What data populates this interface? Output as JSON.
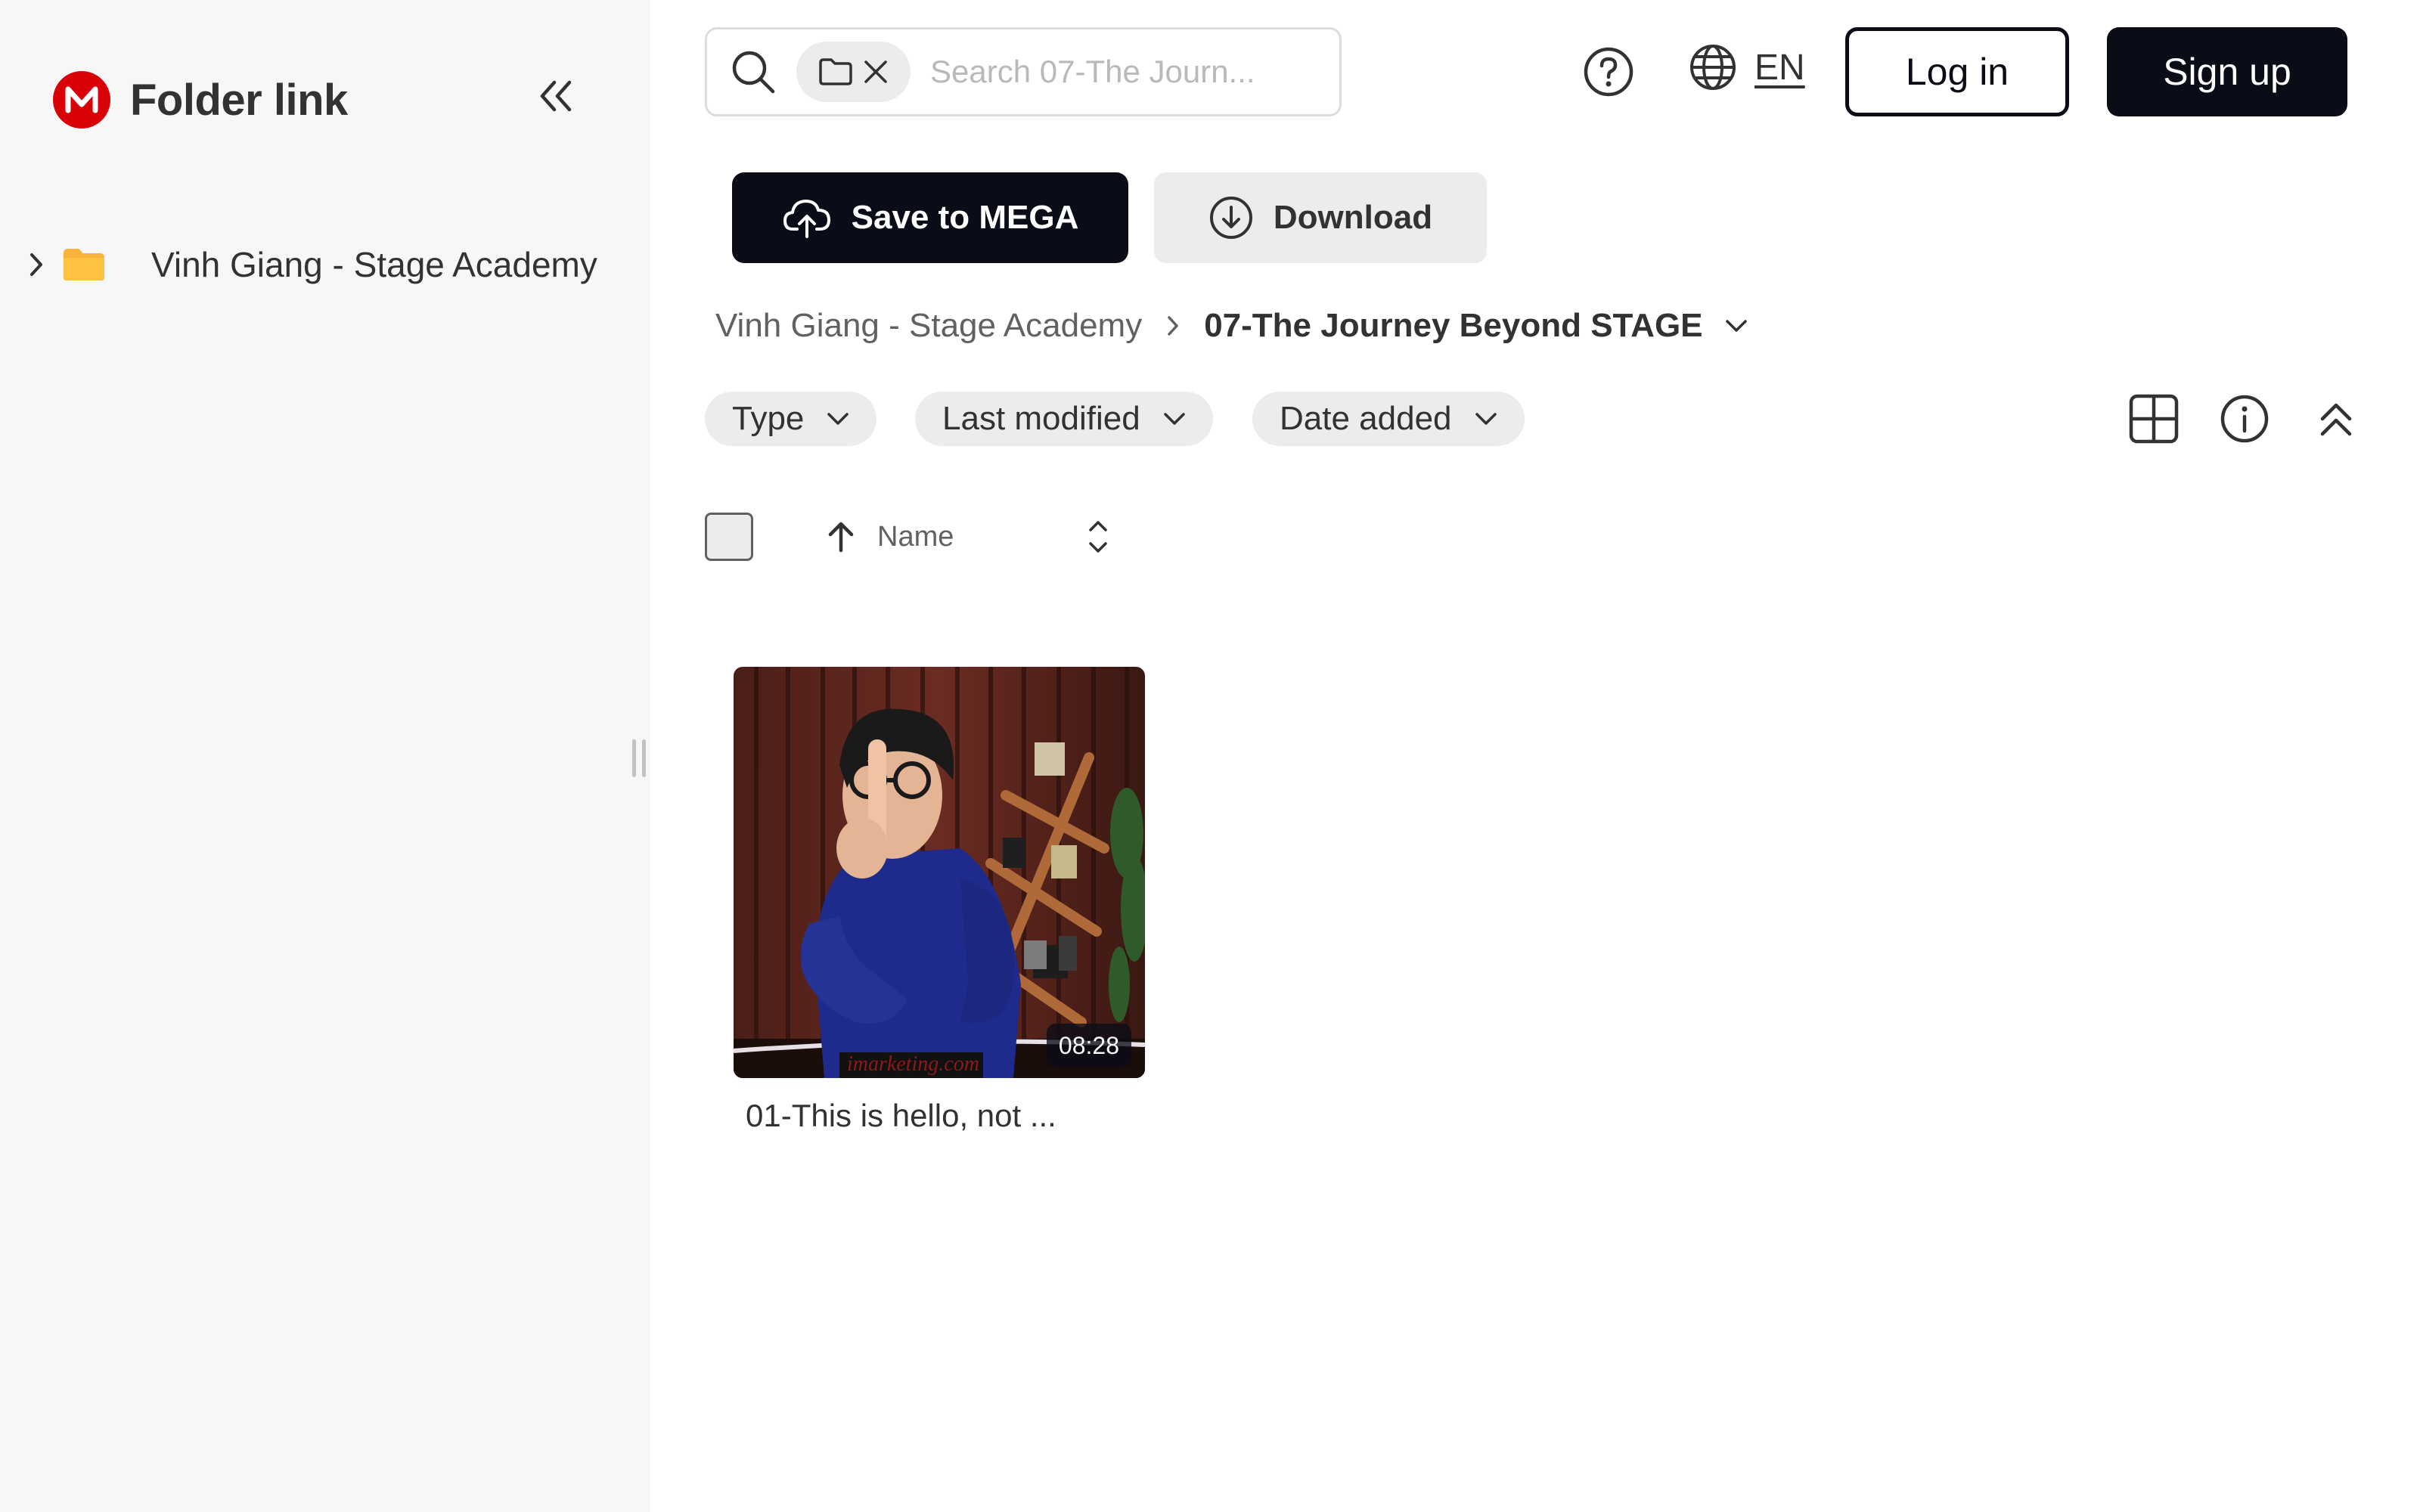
{
  "sidebar": {
    "title": "Folder link",
    "tree": [
      {
        "label": "Vinh Giang - Stage Academy"
      }
    ]
  },
  "search": {
    "placeholder": "Search 07-The Journ..."
  },
  "header": {
    "language": "EN",
    "login_label": "Log in",
    "signup_label": "Sign up"
  },
  "actions": {
    "save_label": "Save to MEGA",
    "download_label": "Download"
  },
  "breadcrumb": {
    "parent": "Vinh Giang - Stage Academy",
    "current": "07-The Journey Beyond STAGE"
  },
  "filters": [
    {
      "label": "Type"
    },
    {
      "label": "Last modified"
    },
    {
      "label": "Date added"
    }
  ],
  "list_header": {
    "name_label": "Name"
  },
  "items": [
    {
      "name": "01-This is hello, not ...",
      "duration": "08:28",
      "thumbnail_watermark": "imarketing.com"
    }
  ],
  "colors": {
    "brand_red": "#d90007",
    "dark": "#0a0d17",
    "sidebar_bg": "#f7f7f7",
    "chip_bg": "#ececec",
    "folder_yellow": "#f9b33c"
  }
}
